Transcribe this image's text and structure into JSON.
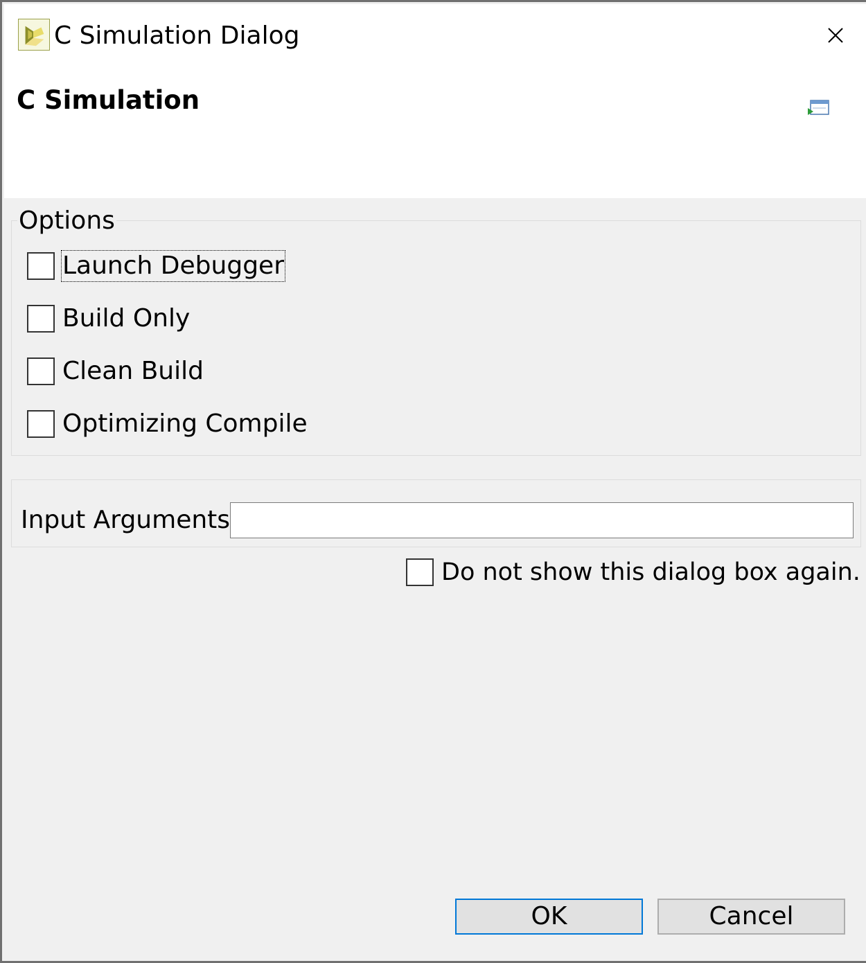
{
  "window": {
    "title": "C Simulation Dialog",
    "app_icon": "vivado-hls-logo-icon",
    "close_icon": "close-icon"
  },
  "banner": {
    "title": "C Simulation",
    "icon": "run-window-icon"
  },
  "options": {
    "legend": "Options",
    "items": [
      {
        "label": "Launch Debugger",
        "checked": false,
        "focused": true
      },
      {
        "label": "Build Only",
        "checked": false
      },
      {
        "label": "Clean Build",
        "checked": false
      },
      {
        "label": "Optimizing Compile",
        "checked": false
      }
    ]
  },
  "input_arguments": {
    "label": "Input Arguments",
    "value": ""
  },
  "do_not_show": {
    "label": "Do not show this dialog box again.",
    "checked": false
  },
  "buttons": {
    "ok_label": "OK",
    "cancel_label": "Cancel"
  },
  "colors": {
    "default_button_border": "#0078d7",
    "logo_fill": "#f0e08a",
    "logo_dark": "#8c8f2a"
  }
}
